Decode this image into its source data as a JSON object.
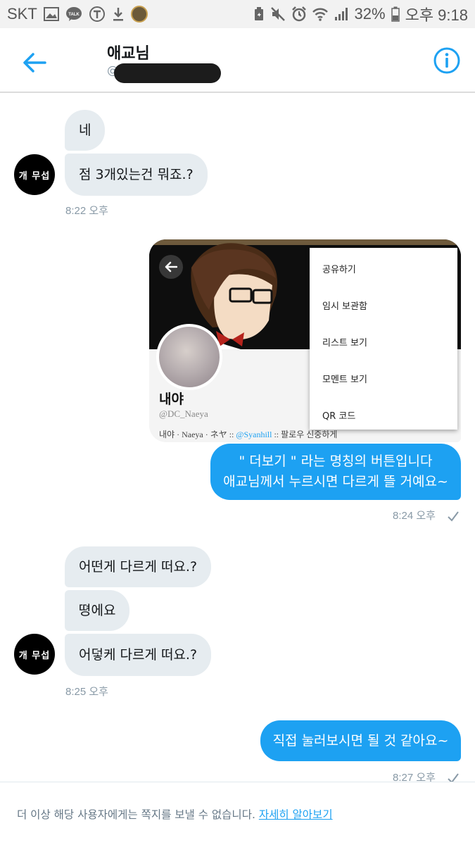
{
  "status_bar": {
    "carrier": "SKT",
    "battery": "32%",
    "time": "오후 9:18"
  },
  "header": {
    "title": "애교님",
    "handle_prefix": "@",
    "back_icon": "arrow-left-icon",
    "info_icon": "info-circle-icon",
    "accent": "#1da1f2"
  },
  "contact": {
    "avatar_text": "개 무섭"
  },
  "messages": {
    "group1": {
      "bubbles": [
        "네",
        "점 3개있는건 뭐죠.?"
      ],
      "time": "8:22 오후"
    },
    "embed": {
      "name": "내야",
      "handle": "@DC_Naeya",
      "bio_prefix": "내야 · Naeya · ネヤ :: ",
      "bio_link": "@Syanhill",
      "bio_suffix": " :: 팔로우 신중하게",
      "menu_items": [
        "공유하기",
        "임시 보관함",
        "리스트 보기",
        "모멘트 보기",
        "QR 코드"
      ]
    },
    "out1": {
      "lines": [
        "\" 더보기 \" 라는 명칭의 버튼입니다",
        "애교님께서 누르시면 다르게 뜰 거예요~"
      ],
      "time": "8:24 오후"
    },
    "group2": {
      "bubbles": [
        "어떤게 다르게 떠요.?",
        "뗭에요",
        "어덯케 다르게 떠요.?"
      ],
      "time": "8:25 오후"
    },
    "out2": {
      "text": "직접 눌러보시면 될 것 같아요~",
      "time": "8:27 오후"
    }
  },
  "footer": {
    "text": "더 이상 해당 사용자에게는 쪽지를 보낼 수 없습니다.",
    "link": "자세히 알아보기"
  }
}
